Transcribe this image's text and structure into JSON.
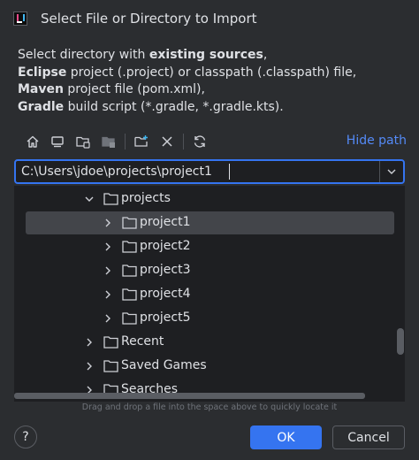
{
  "window": {
    "title": "Select File or Directory to Import"
  },
  "description": {
    "line1_prefix": "Select directory with ",
    "line1_bold": "existing sources",
    "line1_suffix": ",",
    "line2_bold": "Eclipse",
    "line2_rest": " project (.project) or classpath (.classpath) file,",
    "line3_bold": "Maven",
    "line3_rest": " project file (pom.xml),",
    "line4_bold": "Gradle",
    "line4_rest": " build script (*.gradle, *.gradle.kts)."
  },
  "toolbar": {
    "icons": [
      "home-icon",
      "desktop-icon",
      "project-folder-icon",
      "module-folder-icon",
      "new-folder-icon",
      "delete-icon",
      "refresh-icon"
    ],
    "hide_path_label": "Hide path"
  },
  "path_field": {
    "value": "C:\\Users\\jdoe\\projects\\project1"
  },
  "tree": {
    "items": [
      {
        "label": "projects",
        "expanded": true,
        "selected": false,
        "depth": 0
      },
      {
        "label": "project1",
        "expanded": false,
        "selected": true,
        "depth": 1
      },
      {
        "label": "project2",
        "expanded": false,
        "selected": false,
        "depth": 1
      },
      {
        "label": "project3",
        "expanded": false,
        "selected": false,
        "depth": 1
      },
      {
        "label": "project4",
        "expanded": false,
        "selected": false,
        "depth": 1
      },
      {
        "label": "project5",
        "expanded": false,
        "selected": false,
        "depth": 1
      },
      {
        "label": "Recent",
        "expanded": false,
        "selected": false,
        "depth": 0
      },
      {
        "label": "Saved Games",
        "expanded": false,
        "selected": false,
        "depth": 0
      },
      {
        "label": "Searches",
        "expanded": false,
        "selected": false,
        "depth": 0
      }
    ]
  },
  "hint": "Drag and drop a file into the space above to quickly locate it",
  "buttons": {
    "help_label": "?",
    "ok_label": "OK",
    "cancel_label": "Cancel"
  },
  "colors": {
    "background": "#2b2d30",
    "field_background": "#1e1f22",
    "accent": "#3574f0",
    "link": "#548af7",
    "selection": "#43454a"
  }
}
